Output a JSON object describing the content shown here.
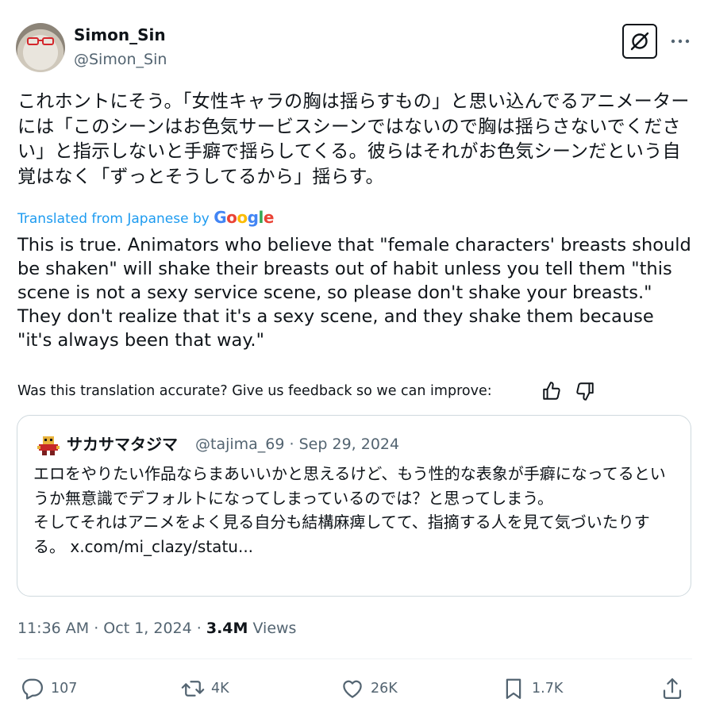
{
  "author": {
    "name": "Simon_Sin",
    "handle": "@Simon_Sin"
  },
  "header_icons": {
    "grok": "grok-icon",
    "more": "more-horizontal-icon"
  },
  "post": {
    "original_text": "これホントにそう。「女性キャラの胸は揺らすもの」と思い込んでるアニメーターには「このシーンはお色気サービスシーンではないので胸は揺らさないでください」と指示しないと手癖で揺らしてくる。彼らはそれがお色気シーンだという自覚はなく「ずっとそうしてるから」揺らす。",
    "translated_label": "Translated from Japanese by",
    "translator": "Google",
    "translated_text": "This is true. Animators who believe that \"female characters' breasts should be shaken\" will shake their breasts out of habit unless you tell them \"this scene is not a sexy service scene, so please don't shake your breasts.\" They don't realize that it's a sexy scene, and they shake them because \"it's always been that way.\"",
    "feedback_prompt": "Was this translation accurate? Give us feedback so we can improve:"
  },
  "quoted": {
    "name": "サカサマタジマ",
    "handle": "@tajima_69",
    "separator": "·",
    "date": "Sep 29, 2024",
    "text": "エロをやりたい作品ならまあいいかと思えるけど、もう性的な表象が手癖になってるというか無意識でデフォルトになってしまっているのでは？と思ってしまう。\nそしてそれはアニメをよく見る自分も結構麻痺してて、指摘する人を見て気づいたりする。 x.com/mi_clazy/statu..."
  },
  "timestamp": {
    "time_date": "11:36 AM · Oct 1, 2024 · ",
    "views_count": "3.4M",
    "views_label": " Views"
  },
  "actions": {
    "replies": "107",
    "reposts": "4K",
    "likes": "26K",
    "bookmarks": "1.7K"
  },
  "colors": {
    "link_blue": "#1d9bf0",
    "secondary_text": "#536471",
    "border": "#cfd9de"
  }
}
